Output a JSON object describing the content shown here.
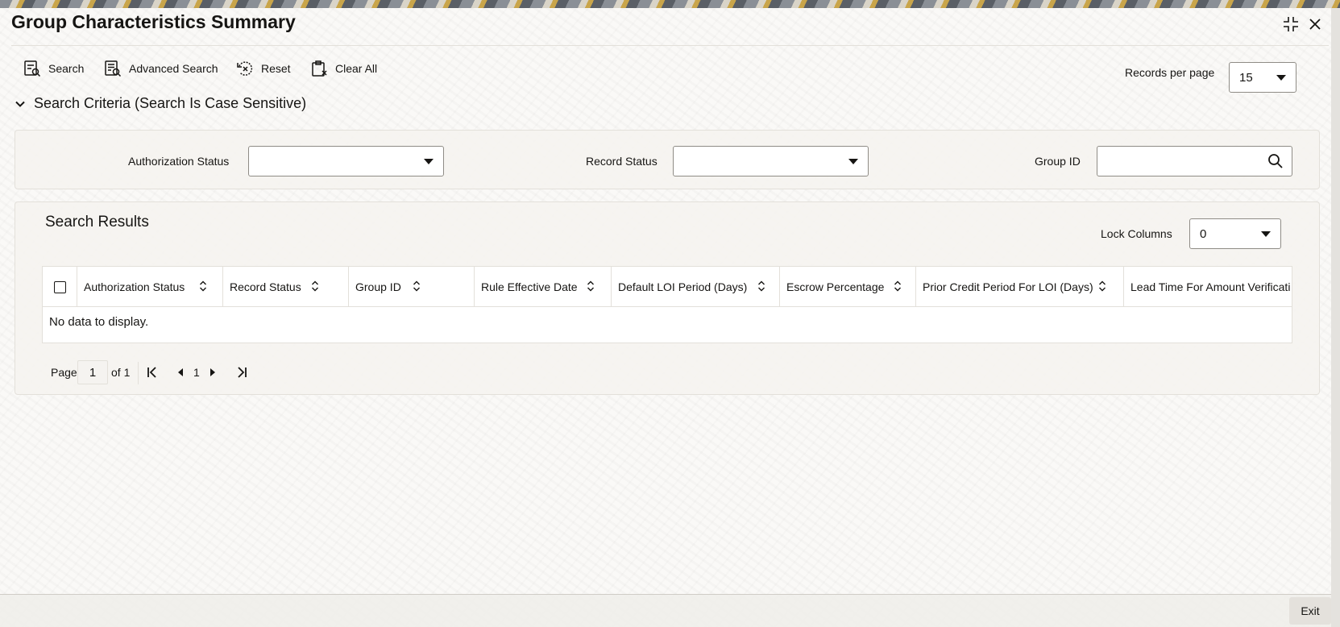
{
  "window": {
    "title": "Group Characteristics Summary"
  },
  "toolbar": {
    "search_label": "Search",
    "advanced_search_label": "Advanced Search",
    "reset_label": "Reset",
    "clear_all_label": "Clear All"
  },
  "records_per_page": {
    "label": "Records per page",
    "value": "15"
  },
  "search_criteria": {
    "header": "Search Criteria (Search Is Case Sensitive)",
    "authorization_status": {
      "label": "Authorization Status",
      "value": ""
    },
    "record_status": {
      "label": "Record Status",
      "value": ""
    },
    "group_id": {
      "label": "Group ID",
      "value": ""
    }
  },
  "results": {
    "title": "Search Results",
    "lock_columns": {
      "label": "Lock Columns",
      "value": "0"
    },
    "columns": [
      "Authorization Status",
      "Record Status",
      "Group ID",
      "Rule Effective Date",
      "Default LOI Period (Days)",
      "Escrow Percentage",
      "Prior Credit Period For LOI (Days)",
      "Lead Time For Amount Verificati"
    ],
    "empty_message": "No data to display."
  },
  "pagination": {
    "page_label": "Page",
    "current_page": "1",
    "of_label": "of 1",
    "page_number": "1"
  },
  "footer": {
    "exit_label": "Exit"
  }
}
